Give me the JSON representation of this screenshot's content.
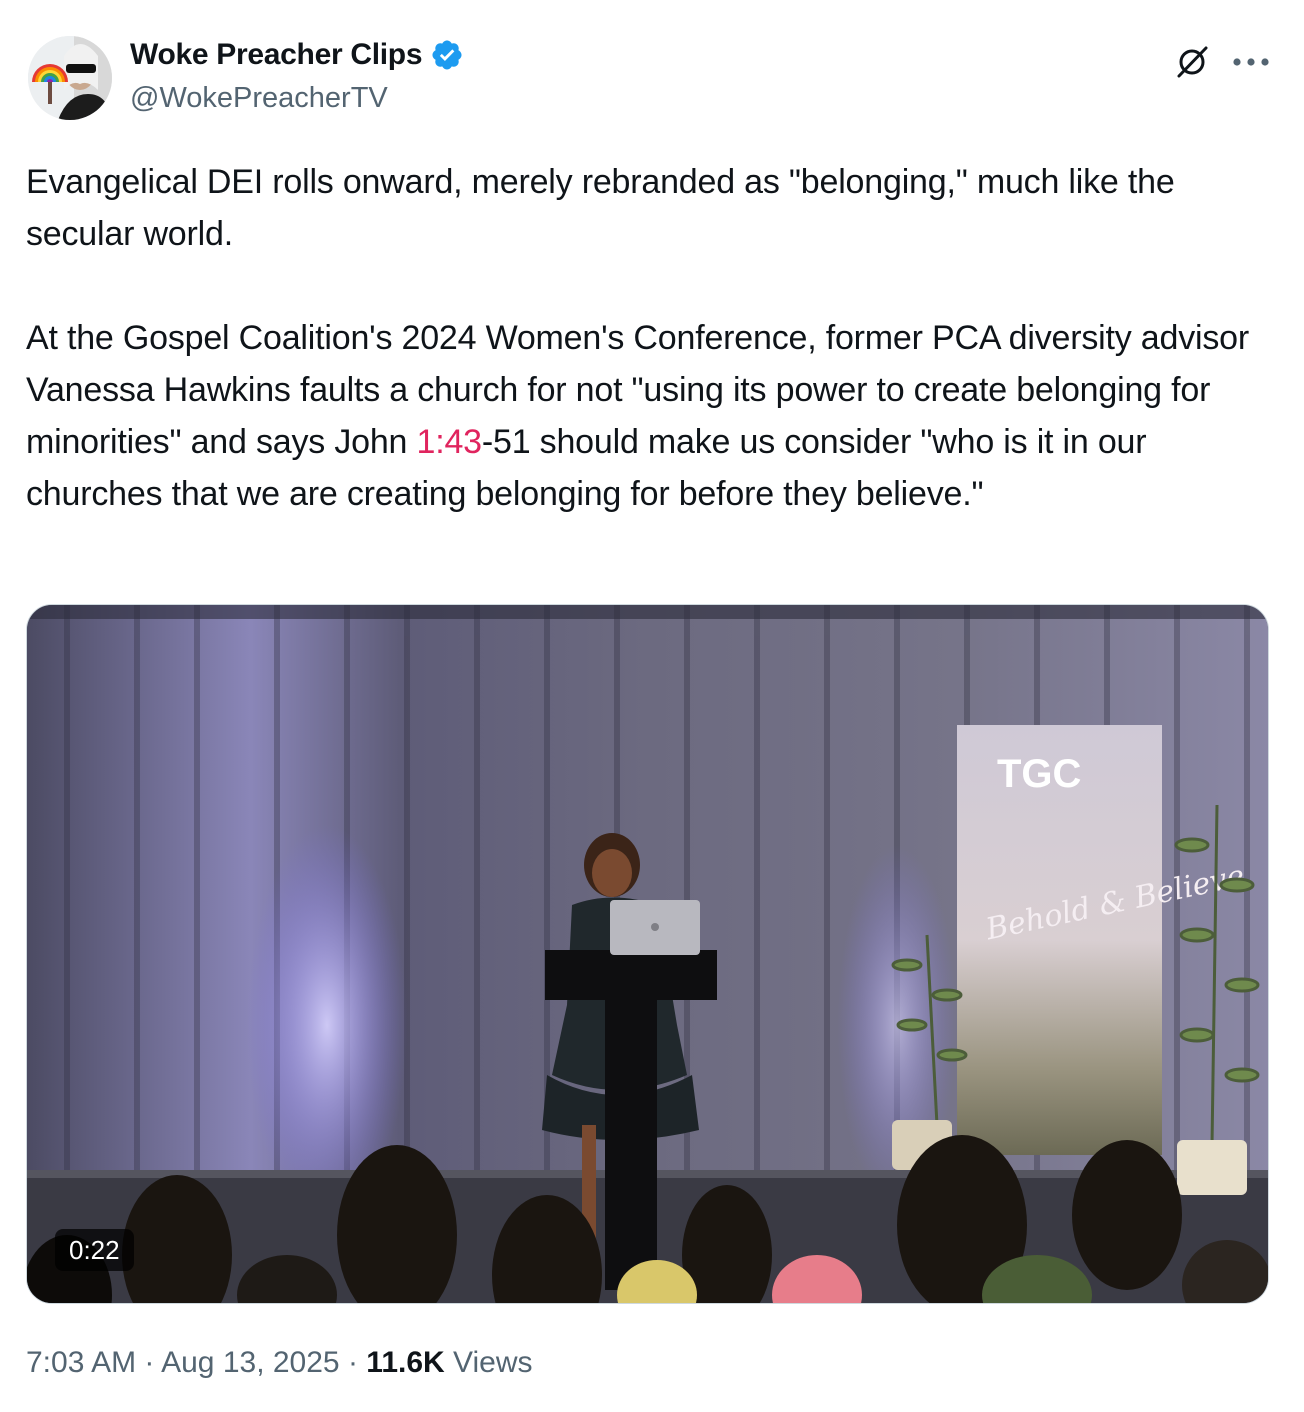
{
  "author": {
    "name": "Woke Preacher Clips",
    "handle": "@WokePreacherTV",
    "verified": true,
    "verified_color": "#1d9bf0"
  },
  "actions": {
    "grok_icon": "grok-icon",
    "more_icon": "more-dots-icon"
  },
  "tweet": {
    "paragraph1": "Evangelical DEI rolls onward, merely rebranded as \"belonging,\" much like the secular world.",
    "paragraph2_before": "At the Gospel Coalition's 2024 Women's Conference, former PCA diversity advisor Vanessa Hawkins faults a church for not \"using its power to create belonging for minorities\" and says John ",
    "paragraph2_link": "1:43",
    "paragraph2_after": "-51 should make us consider \"who is it in our churches that we are creating belonging for before they believe.\"",
    "link_color": "#e0245e"
  },
  "media": {
    "type": "video",
    "duration": "0:22",
    "banner_logo": "TGC",
    "banner_script": "Behold & Believe"
  },
  "meta": {
    "time": "7:03 AM",
    "separator": "·",
    "date": "Aug 13, 2025",
    "views_count": "11.6K",
    "views_label": "Views"
  }
}
